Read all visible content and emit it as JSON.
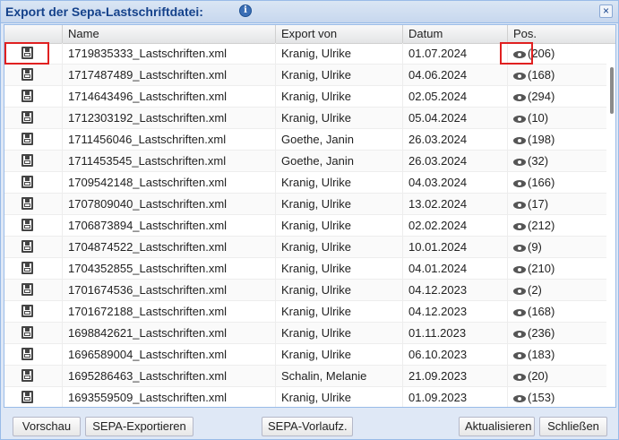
{
  "window": {
    "title": "Export der Sepa-Lastschriftdatei:",
    "info_glyph": "i",
    "close_glyph": "×"
  },
  "columns": {
    "name": "Name",
    "export_von": "Export von",
    "datum": "Datum",
    "pos": "Pos."
  },
  "rows": [
    {
      "name": "1719835333_Lastschriften.xml",
      "export_von": "Kranig, Ulrike",
      "datum": "01.07.2024",
      "pos": "(206)"
    },
    {
      "name": "1717487489_Lastschriften.xml",
      "export_von": "Kranig, Ulrike",
      "datum": "04.06.2024",
      "pos": "(168)"
    },
    {
      "name": "1714643496_Lastschriften.xml",
      "export_von": "Kranig, Ulrike",
      "datum": "02.05.2024",
      "pos": "(294)"
    },
    {
      "name": "1712303192_Lastschriften.xml",
      "export_von": "Kranig, Ulrike",
      "datum": "05.04.2024",
      "pos": "(10)"
    },
    {
      "name": "1711456046_Lastschriften.xml",
      "export_von": "Goethe, Janin",
      "datum": "26.03.2024",
      "pos": "(198)"
    },
    {
      "name": "1711453545_Lastschriften.xml",
      "export_von": "Goethe, Janin",
      "datum": "26.03.2024",
      "pos": "(32)"
    },
    {
      "name": "1709542148_Lastschriften.xml",
      "export_von": "Kranig, Ulrike",
      "datum": "04.03.2024",
      "pos": "(166)"
    },
    {
      "name": "1707809040_Lastschriften.xml",
      "export_von": "Kranig, Ulrike",
      "datum": "13.02.2024",
      "pos": "(17)"
    },
    {
      "name": "1706873894_Lastschriften.xml",
      "export_von": "Kranig, Ulrike",
      "datum": "02.02.2024",
      "pos": "(212)"
    },
    {
      "name": "1704874522_Lastschriften.xml",
      "export_von": "Kranig, Ulrike",
      "datum": "10.01.2024",
      "pos": "(9)"
    },
    {
      "name": "1704352855_Lastschriften.xml",
      "export_von": "Kranig, Ulrike",
      "datum": "04.01.2024",
      "pos": "(210)"
    },
    {
      "name": "1701674536_Lastschriften.xml",
      "export_von": "Kranig, Ulrike",
      "datum": "04.12.2023",
      "pos": "(2)"
    },
    {
      "name": "1701672188_Lastschriften.xml",
      "export_von": "Kranig, Ulrike",
      "datum": "04.12.2023",
      "pos": "(168)"
    },
    {
      "name": "1698842621_Lastschriften.xml",
      "export_von": "Kranig, Ulrike",
      "datum": "01.11.2023",
      "pos": "(236)"
    },
    {
      "name": "1696589004_Lastschriften.xml",
      "export_von": "Kranig, Ulrike",
      "datum": "06.10.2023",
      "pos": "(183)"
    },
    {
      "name": "1695286463_Lastschriften.xml",
      "export_von": "Schalin, Melanie",
      "datum": "21.09.2023",
      "pos": "(20)"
    },
    {
      "name": "1693559509_Lastschriften.xml",
      "export_von": "Kranig, Ulrike",
      "datum": "01.09.2023",
      "pos": "(153)"
    }
  ],
  "buttons": {
    "vorschau": "Vorschau",
    "sepa_exportieren": "SEPA-Exportieren",
    "sepa_vorlaufz": "SEPA-Vorlaufz.",
    "aktualisieren": "Aktualisieren",
    "schliessen": "Schließen"
  },
  "icons": {
    "save": "save-icon",
    "view": "eye-icon",
    "info": "info-icon",
    "close": "close-icon"
  },
  "colors": {
    "title": "#15428b",
    "highlight": "#e02020",
    "window_bg": "#dfe8f6"
  }
}
